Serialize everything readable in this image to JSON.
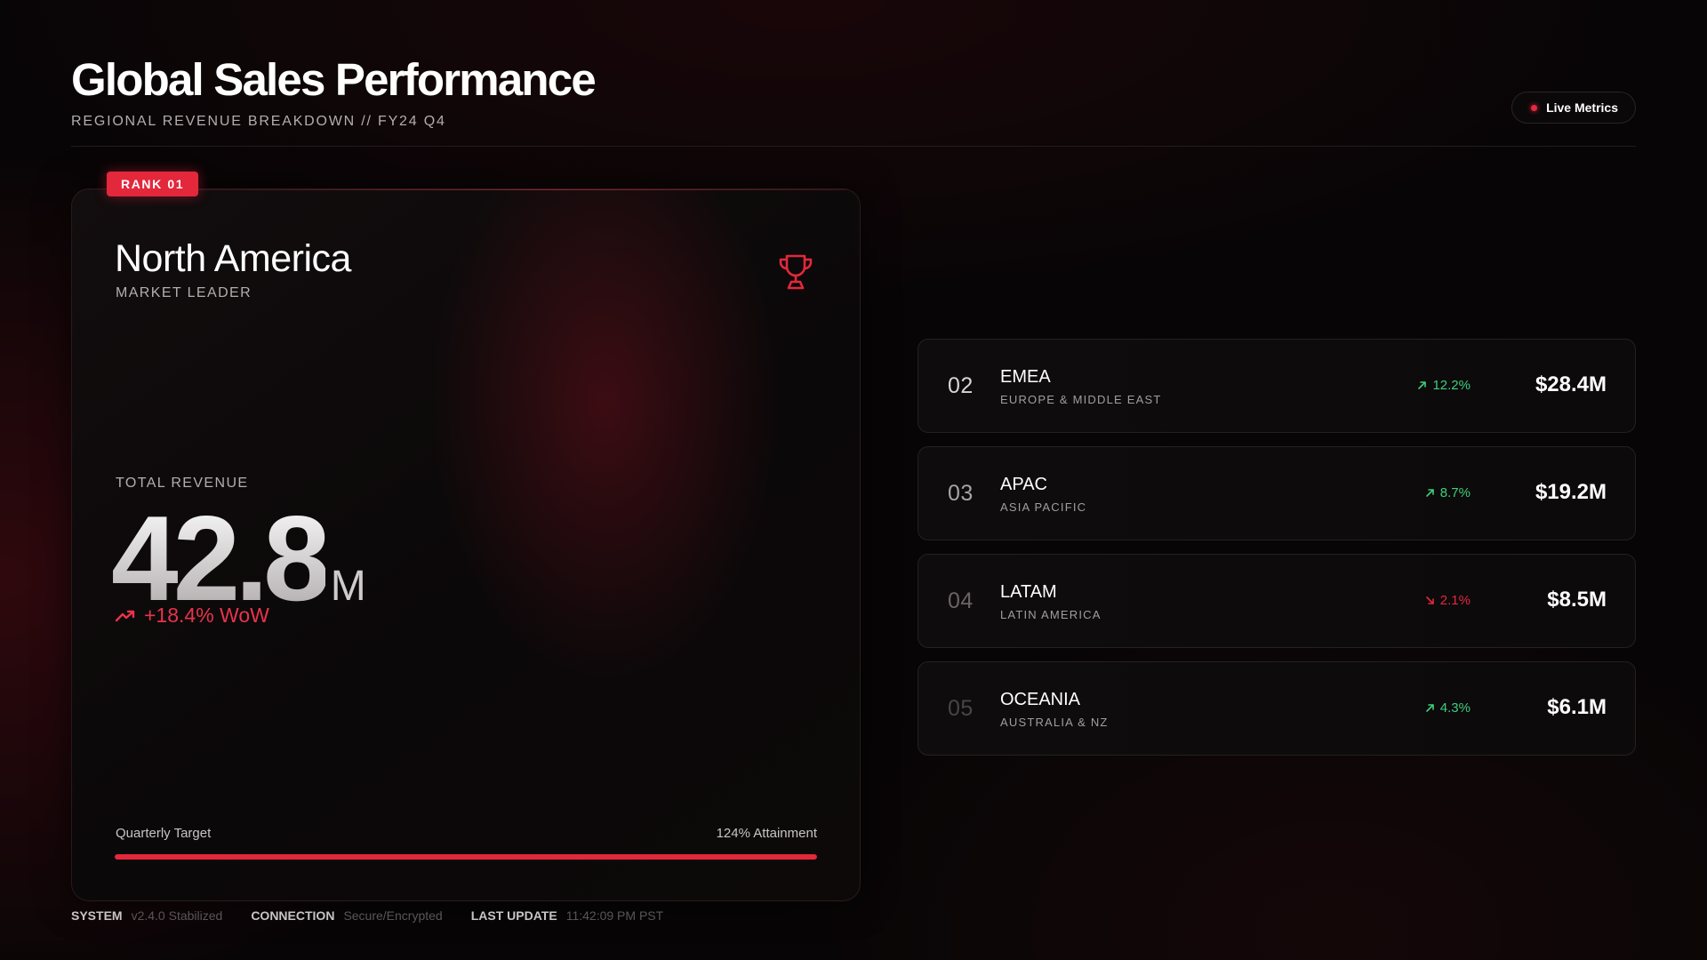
{
  "header": {
    "title": "Global Sales Performance",
    "subtitle": "REGIONAL REVENUE BREAKDOWN // FY24 Q4",
    "live_label": "Live Metrics"
  },
  "hero": {
    "badge": "RANK 01",
    "region": "North America",
    "tag": "MARKET LEADER",
    "icon": "trophy-icon",
    "revenue_label": "TOTAL REVENUE",
    "revenue_value": "42.8",
    "revenue_unit": "M",
    "wow": "+18.4% WoW",
    "target_label": "Quarterly Target",
    "attainment_label": "124% Attainment",
    "attainment_percent": 124
  },
  "regions": [
    {
      "rank": "02",
      "name": "EMEA",
      "sub": "EUROPE & MIDDLE EAST",
      "delta": "12.2%",
      "direction": "up",
      "value": "$28.4M"
    },
    {
      "rank": "03",
      "name": "APAC",
      "sub": "ASIA PACIFIC",
      "delta": "8.7%",
      "direction": "up",
      "value": "$19.2M"
    },
    {
      "rank": "04",
      "name": "LATAM",
      "sub": "LATIN AMERICA",
      "delta": "2.1%",
      "direction": "down",
      "value": "$8.5M"
    },
    {
      "rank": "05",
      "name": "OCEANIA",
      "sub": "AUSTRALIA & NZ",
      "delta": "4.3%",
      "direction": "up",
      "value": "$6.1M"
    }
  ],
  "footer": {
    "system_key": "SYSTEM",
    "system_val": "v2.4.0 Stabilized",
    "connection_key": "CONNECTION",
    "connection_val": "Secure/Encrypted",
    "update_key": "LAST UPDATE",
    "update_val": "11:42:09 PM PST"
  },
  "colors": {
    "accent": "#e3283c",
    "positive": "#3ecf7a",
    "negative": "#e3283c",
    "rank_colors": [
      "#d9d4d5",
      "#a9a3a4",
      "#6a6365",
      "#4a4446"
    ]
  }
}
